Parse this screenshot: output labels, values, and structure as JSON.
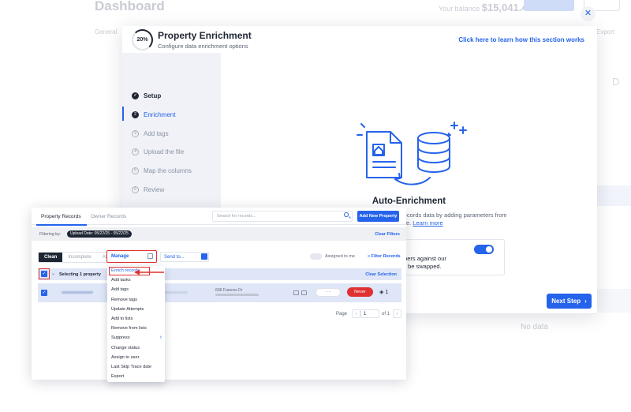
{
  "background": {
    "title": "Dashboard",
    "budget_label": "Your balance",
    "budget_value": "$15,041.48",
    "tab_left": "General",
    "tab_right": "Export",
    "letter": "D",
    "no_data": "No data"
  },
  "modal": {
    "progress": "20%",
    "title": "Property Enrichment",
    "subtitle": "Configure data enrichment options",
    "learn_link": "Click here to learn how this section works",
    "steps": [
      {
        "num": "✓",
        "label": "Setup"
      },
      {
        "num": "2",
        "label": "Enrichment"
      },
      {
        "num": "3",
        "label": "Add tags"
      },
      {
        "num": "4",
        "label": "Upload the file"
      },
      {
        "num": "5",
        "label": "Map the columns"
      },
      {
        "num": "6",
        "label": "Review"
      }
    ],
    "auto_title": "Auto-Enrichment",
    "auto_desc": "We will enrich property and owner records data by adding parameters from our database.",
    "learn_more": "Learn more",
    "info_line1": "mers against our",
    "info_line2": "ill be swapped.",
    "next_label": "Next Step",
    "toggle_on": true
  },
  "panel": {
    "tab_property": "Property Records",
    "tab_owner": "Owner Records",
    "search_placeholder": "Search for records...",
    "add_button": "Add New Property",
    "filter_label": "Filtering by:",
    "filter_chip": "Upload Date: 05/22/25 - 05/22/25",
    "clear_filters": "Clear Filters",
    "seg_clean": "Clean",
    "seg_incomplete": "Incomplete",
    "seg_all": "All",
    "manage_label": "Manage",
    "sendto_label": "Send to...",
    "assigned_label": "Assigned to me",
    "filter_records": "Filter Records",
    "selecting_text": "Selecting 1 property",
    "clear_selection": "Clear Selection",
    "row_address": "608 Frances Dr",
    "row_pill": "- -",
    "row_badge": "Never",
    "row_count": "1",
    "page_label": "Page",
    "page_value": "1",
    "page_of": "of 1"
  },
  "menu": {
    "items": [
      "Enrich records",
      "Add tasks",
      "Add tags",
      "Remove tags",
      "Update Attempts",
      "Add to lists",
      "Remove from lists",
      "Suppress",
      "Change status",
      "Assign to user",
      "Last Skip Trace date",
      "Export"
    ]
  },
  "colors": {
    "accent": "#2563eb",
    "highlight": "#e03131",
    "dark": "#1e2533"
  }
}
